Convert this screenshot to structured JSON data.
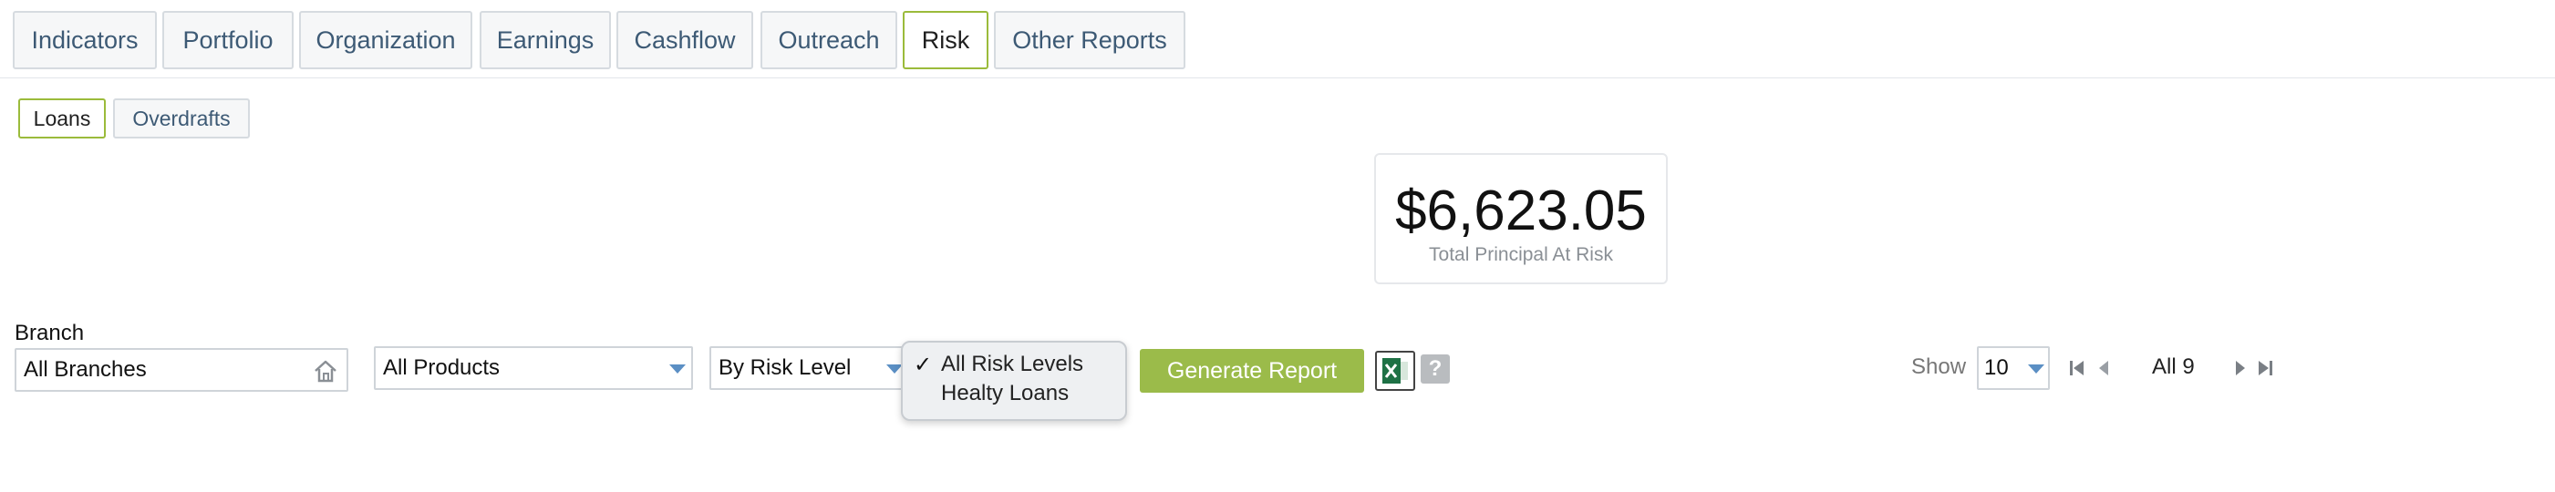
{
  "tabs": [
    {
      "label": "Indicators",
      "active": false
    },
    {
      "label": "Portfolio",
      "active": false
    },
    {
      "label": "Organization",
      "active": false
    },
    {
      "label": "Earnings",
      "active": false
    },
    {
      "label": "Cashflow",
      "active": false
    },
    {
      "label": "Outreach",
      "active": false
    },
    {
      "label": "Risk",
      "active": true
    },
    {
      "label": "Other Reports",
      "active": false
    }
  ],
  "subtabs": [
    {
      "label": "Loans",
      "active": true
    },
    {
      "label": "Overdrafts",
      "active": false
    }
  ],
  "kpi": {
    "value": "$6,623.05",
    "label": "Total Principal At Risk"
  },
  "filters": {
    "branch_label": "Branch",
    "branch_value": "All Branches",
    "product_value": "All Products",
    "grouping_value": "By Risk Level"
  },
  "risk_dropdown": {
    "options": [
      "All Risk Levels",
      "Healty Loans"
    ],
    "selected_index": 0
  },
  "actions": {
    "generate_label": "Generate Report",
    "help_label": "?"
  },
  "pager": {
    "show_label": "Show",
    "page_size": "10",
    "summary": "All 9"
  },
  "icons": {
    "branch": "home-icon",
    "excel": "excel-icon",
    "first": "first-page-icon",
    "prev": "prev-page-icon",
    "next": "next-page-icon",
    "last": "last-page-icon"
  },
  "colors": {
    "accent": "#9bbb4a",
    "tab_text": "#3d5a75",
    "caret": "#5b8fc4",
    "excel_green": "#1e7145"
  }
}
